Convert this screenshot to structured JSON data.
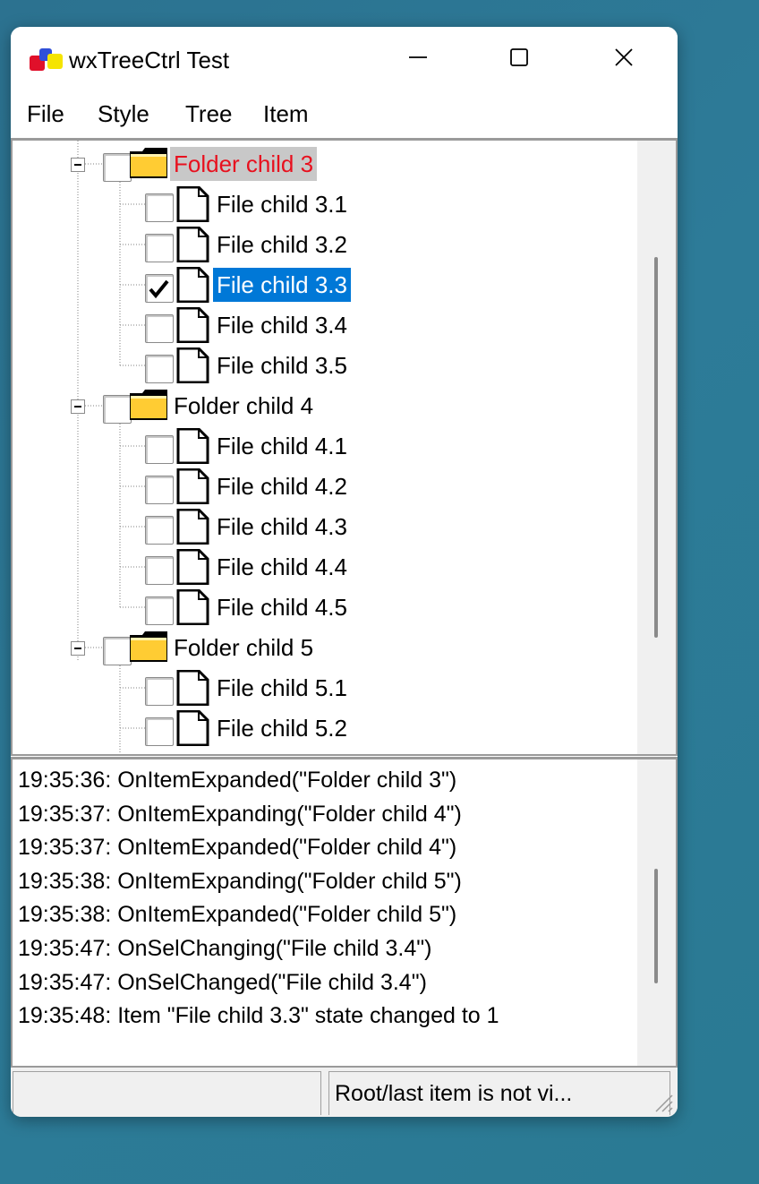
{
  "window": {
    "title": "wxTreeCtrl Test"
  },
  "menubar": {
    "items": [
      "File",
      "Style",
      "Tree",
      "Item"
    ]
  },
  "tree": {
    "rows": [
      {
        "label": "Folder child 3",
        "kind": "folder",
        "level": 1,
        "checked": false,
        "state": "highlighted",
        "expanded": true
      },
      {
        "label": "File child 3.1",
        "kind": "file",
        "level": 2,
        "checked": false,
        "state": "normal"
      },
      {
        "label": "File child 3.2",
        "kind": "file",
        "level": 2,
        "checked": false,
        "state": "normal"
      },
      {
        "label": "File child 3.3",
        "kind": "file",
        "level": 2,
        "checked": true,
        "state": "selected"
      },
      {
        "label": "File child 3.4",
        "kind": "file",
        "level": 2,
        "checked": false,
        "state": "normal"
      },
      {
        "label": "File child 3.5",
        "kind": "file",
        "level": 2,
        "checked": false,
        "state": "normal"
      },
      {
        "label": "Folder child 4",
        "kind": "folder",
        "level": 1,
        "checked": false,
        "state": "normal",
        "expanded": true
      },
      {
        "label": "File child 4.1",
        "kind": "file",
        "level": 2,
        "checked": false,
        "state": "normal"
      },
      {
        "label": "File child 4.2",
        "kind": "file",
        "level": 2,
        "checked": false,
        "state": "normal"
      },
      {
        "label": "File child 4.3",
        "kind": "file",
        "level": 2,
        "checked": false,
        "state": "normal"
      },
      {
        "label": "File child 4.4",
        "kind": "file",
        "level": 2,
        "checked": false,
        "state": "normal"
      },
      {
        "label": "File child 4.5",
        "kind": "file",
        "level": 2,
        "checked": false,
        "state": "normal"
      },
      {
        "label": "Folder child 5",
        "kind": "folder",
        "level": 1,
        "checked": false,
        "state": "normal",
        "expanded": true
      },
      {
        "label": "File child 5.1",
        "kind": "file",
        "level": 2,
        "checked": false,
        "state": "normal"
      },
      {
        "label": "File child 5.2",
        "kind": "file",
        "level": 2,
        "checked": false,
        "state": "normal"
      }
    ]
  },
  "log": {
    "lines": [
      "19:35:36: OnItemExpanded(\"Folder child 3\")",
      "19:35:37: OnItemExpanding(\"Folder child 4\")",
      "19:35:37: OnItemExpanded(\"Folder child 4\")",
      "19:35:38: OnItemExpanding(\"Folder child 5\")",
      "19:35:38: OnItemExpanded(\"Folder child 5\")",
      "19:35:47: OnSelChanging(\"File child 3.4\")",
      "19:35:47: OnSelChanged(\"File child 3.4\")",
      "19:35:48: Item \"File child 3.3\" state changed to 1"
    ]
  },
  "statusbar": {
    "field1": "",
    "field2": "Root/last item is not vi..."
  },
  "colors": {
    "selected_bg": "#0078d7",
    "highlight_text": "#e8101e",
    "highlight_bg": "#c8c8c8",
    "folder": "#ffcc33"
  }
}
